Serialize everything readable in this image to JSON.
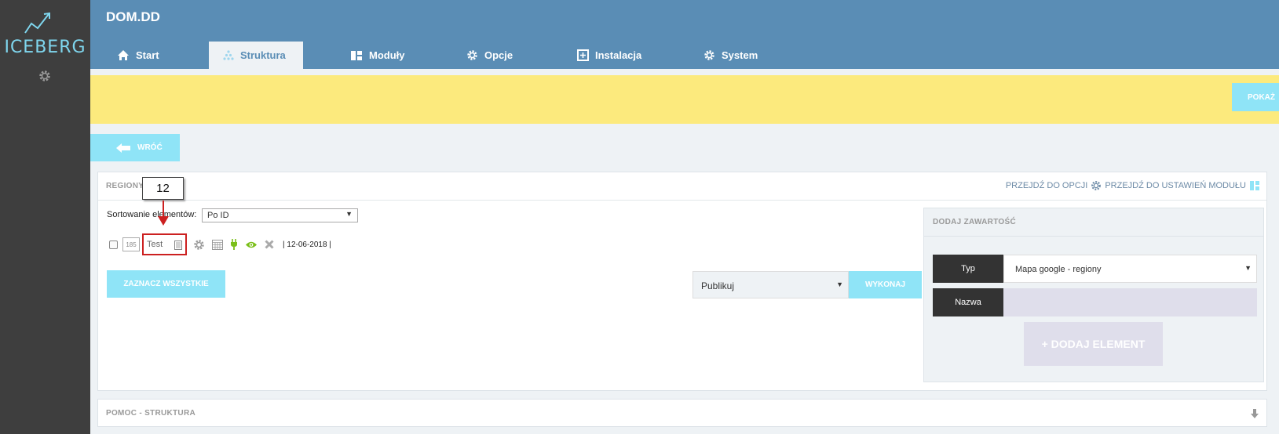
{
  "sidebar": {
    "logo_text": "ICEBERG"
  },
  "header": {
    "app_title": "DOM.DD",
    "tabs": [
      {
        "label": "Start",
        "icon": "home-icon"
      },
      {
        "label": "Struktura",
        "icon": "structure-icon",
        "active": true
      },
      {
        "label": "Moduły",
        "icon": "modules-icon"
      },
      {
        "label": "Opcje",
        "icon": "gear-icon"
      },
      {
        "label": "Instalacja",
        "icon": "installation-icon"
      },
      {
        "label": "System",
        "icon": "gear-icon"
      }
    ]
  },
  "notice": {
    "button_label": "POKAŻ"
  },
  "back_button": {
    "label": "WRÓĆ"
  },
  "panel": {
    "title": "REGIONY",
    "link_options": "PRZEJDŹ DO OPCJI",
    "link_module_settings": "PRZEJDŹ DO USTAWIEŃ MODUŁU",
    "sort_label": "Sortowanie elementów:",
    "sort_value": "Po ID",
    "annotation_number": "12",
    "items": [
      {
        "id": "185",
        "name": "Test",
        "date": "| 12-06-2018 |"
      }
    ],
    "select_all_label": "ZAZNACZ WSZYSTKIE",
    "action_value": "Publikuj",
    "execute_label": "WYKONAJ"
  },
  "add_content": {
    "title": "DODAJ ZAWARTOŚĆ",
    "type_label": "Typ",
    "type_value": "Mapa google - regiony",
    "name_label": "Nazwa",
    "name_value": "",
    "add_button": "+ DODAJ ELEMENT"
  },
  "help": {
    "title": "POMOC - STRUKTURA"
  },
  "colors": {
    "sidebar_bg": "#3e3e3e",
    "header_bg": "#5a8db5",
    "notice_bg": "#fcea7d",
    "accent_button": "#8fe4f7",
    "annotation_red": "#cc2020"
  }
}
